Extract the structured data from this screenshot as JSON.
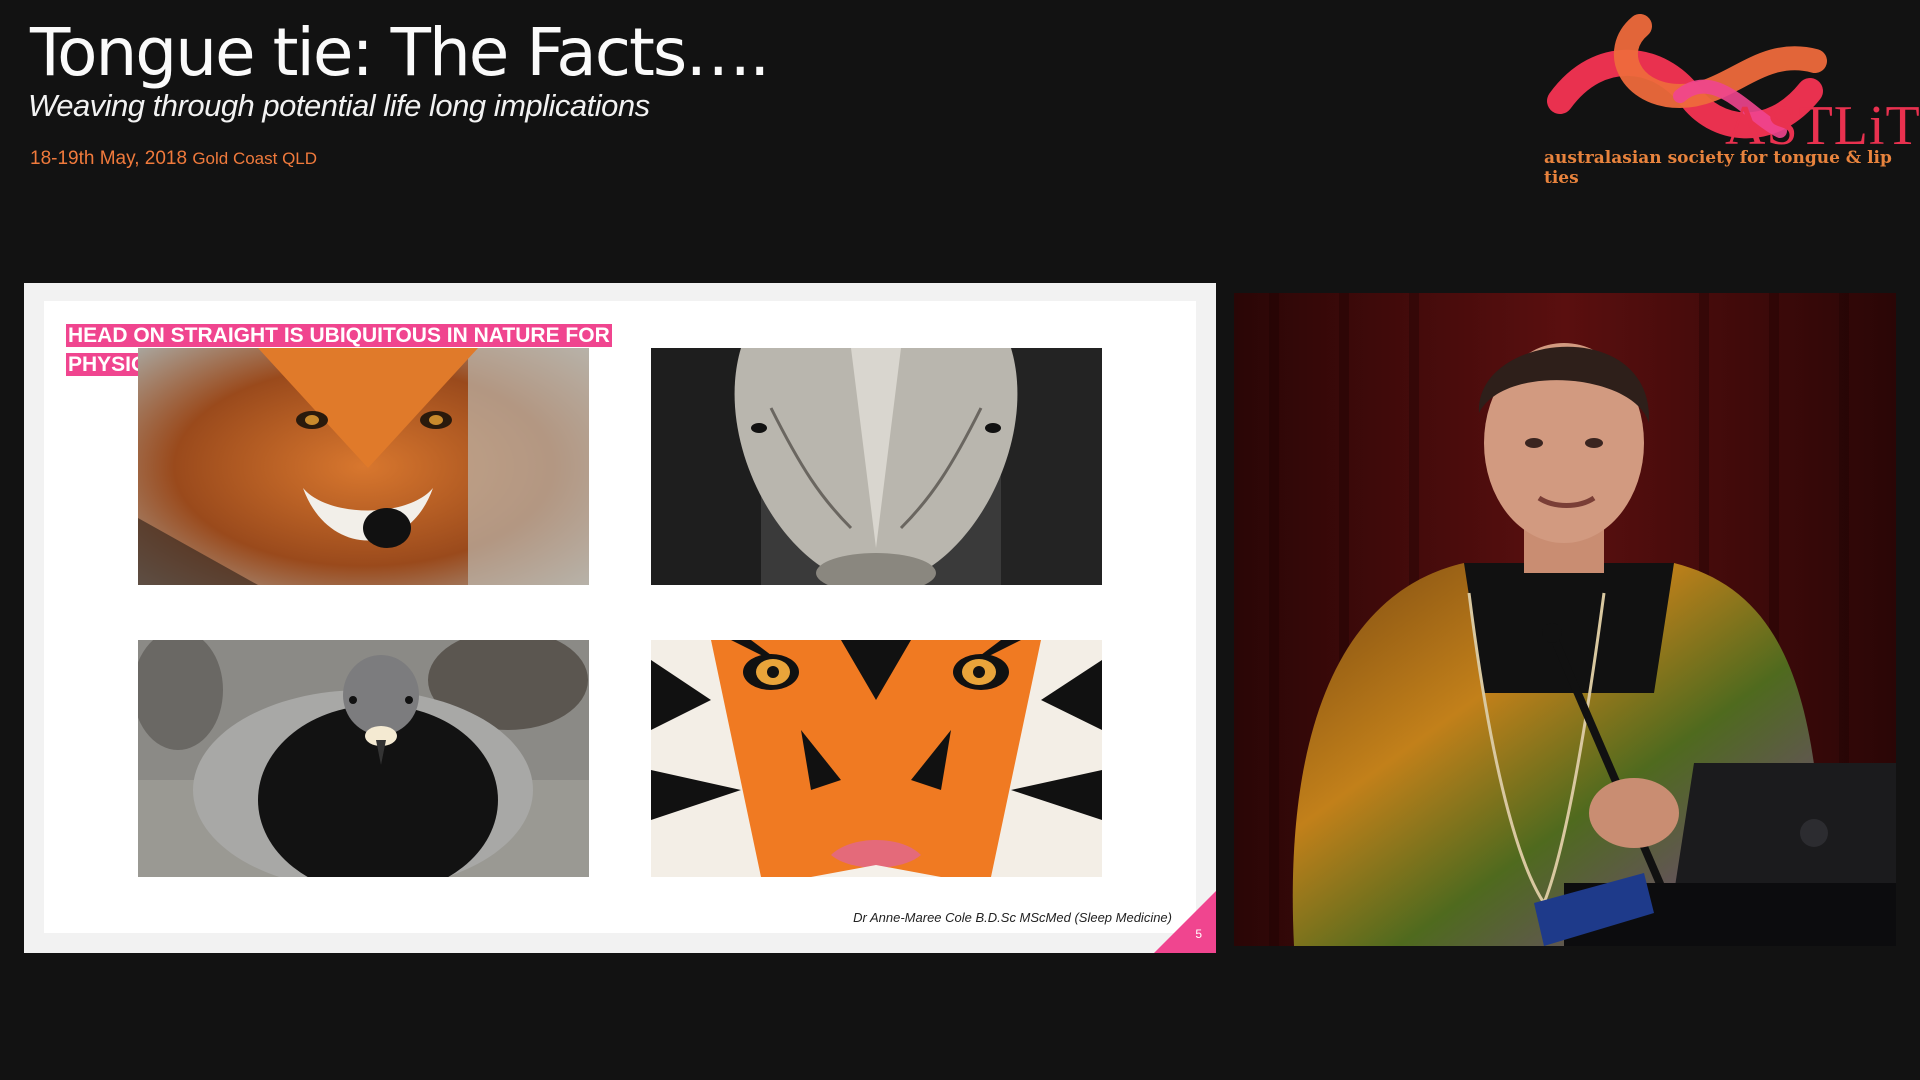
{
  "header": {
    "title": "Tongue tie: The Facts….",
    "subtitle": "Weaving through potential life long implications",
    "date": "18-19th May, 2018",
    "location": "Gold Coast QLD"
  },
  "logo": {
    "word": "ASTLiT",
    "tagline": "australasian society for tongue & lip ties"
  },
  "slide": {
    "heading_line1": "HEAD ON STRAIGHT IS UBIQUITOUS IN NATURE FOR",
    "heading_line2": "PHYSIOLOGIC ECONOMY AND SURVIVAL",
    "credit": "Dr Anne-Maree Cole B.D.Sc MScMed (Sleep Medicine)",
    "page_number": "5",
    "photos": [
      "fox",
      "rhinoceros",
      "pigeon",
      "tiger"
    ]
  },
  "colors": {
    "background": "#121212",
    "accent_pink": "#f0458f",
    "accent_orange": "#f07a3c",
    "logo_red": "#e9314f"
  }
}
